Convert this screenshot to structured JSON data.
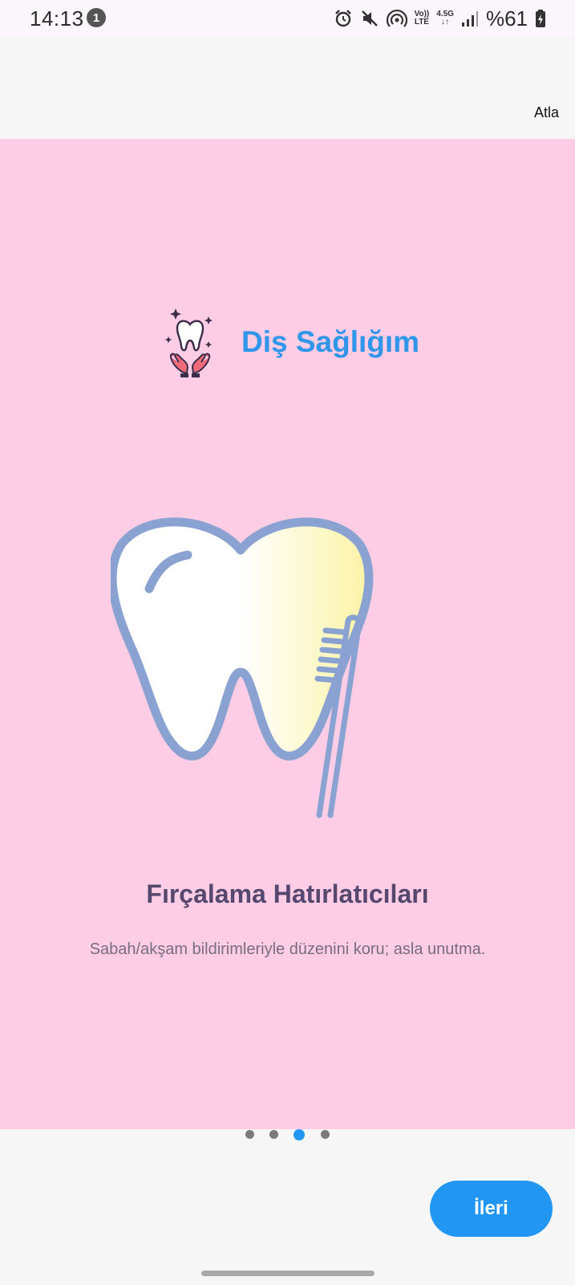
{
  "status_bar": {
    "time": "14:13",
    "notification_count": "1",
    "network_top": "Vo))",
    "network_bottom": "LTE",
    "data_top": "4.5G",
    "data_bottom": "↓↑",
    "battery": "%61",
    "icons": [
      "alarm-icon",
      "mute-icon",
      "hotspot-icon",
      "volte-icon",
      "data-icon",
      "signal-icon",
      "battery-icon"
    ]
  },
  "header": {
    "skip_label": "Atla"
  },
  "slide": {
    "background_color": "#fccde4",
    "brand_title": "Diş Sağlığım",
    "brand_icon": "tooth-hands-icon",
    "illustration": "tooth-toothbrush-illustration",
    "title": "Fırçalama Hatırlatıcıları",
    "description": "Sabah/akşam bildirimleriyle düzenini koru; asla unutma."
  },
  "pager": {
    "page_count": 4,
    "current_page": 3,
    "active_color": "#2196f3"
  },
  "footer": {
    "next_label": "İleri"
  },
  "colors": {
    "accent": "#2196f3",
    "title_text": "#55476e"
  }
}
